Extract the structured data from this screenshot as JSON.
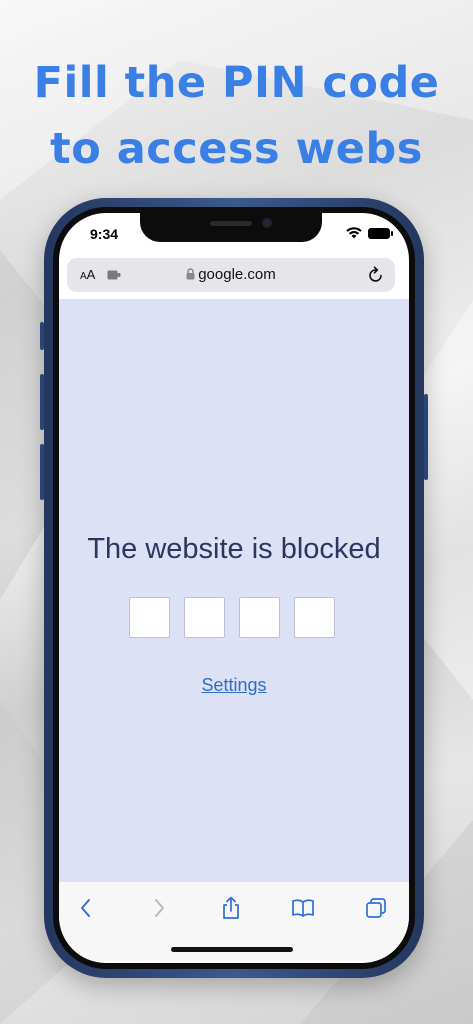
{
  "headline": {
    "line1": "Fill the PIN code",
    "line2": "to access webs"
  },
  "status_bar": {
    "time": "9:34",
    "icons": [
      "wifi-icon",
      "battery-icon"
    ]
  },
  "browser": {
    "reader_label_small": "A",
    "reader_label_large": "A",
    "url": "google.com"
  },
  "page": {
    "title": "The website is blocked",
    "pin_digits": [
      "",
      "",
      "",
      ""
    ],
    "settings_link": "Settings"
  },
  "toolbar": {
    "items": [
      "back-icon",
      "forward-icon",
      "share-icon",
      "bookmarks-icon",
      "tabs-icon"
    ]
  },
  "colors": {
    "headline": "#3a7fe6",
    "page_background": "#dce1f6",
    "title_text": "#2d3560",
    "link": "#2e6fc4",
    "toolbar_icon": "#2f6fd6",
    "phone_frame": "#2a4476"
  }
}
